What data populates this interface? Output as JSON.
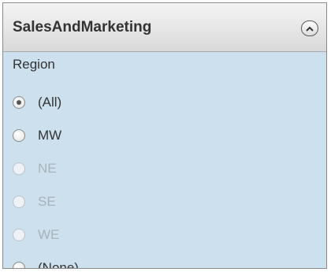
{
  "panel": {
    "title": "SalesAndMarketing",
    "collapse_icon": "chevron-up-circle-icon"
  },
  "filter": {
    "label": "Region",
    "selected": "(All)",
    "options": [
      {
        "label": "(All)",
        "checked": true,
        "enabled": true
      },
      {
        "label": "MW",
        "checked": false,
        "enabled": true
      },
      {
        "label": "NE",
        "checked": false,
        "enabled": false
      },
      {
        "label": "SE",
        "checked": false,
        "enabled": false
      },
      {
        "label": "WE",
        "checked": false,
        "enabled": false
      },
      {
        "label": "(None)",
        "checked": false,
        "enabled": true
      }
    ]
  },
  "colors": {
    "panel_bg": "#cde0ee",
    "text": "#333333",
    "disabled_text": "#a8b2bb"
  }
}
